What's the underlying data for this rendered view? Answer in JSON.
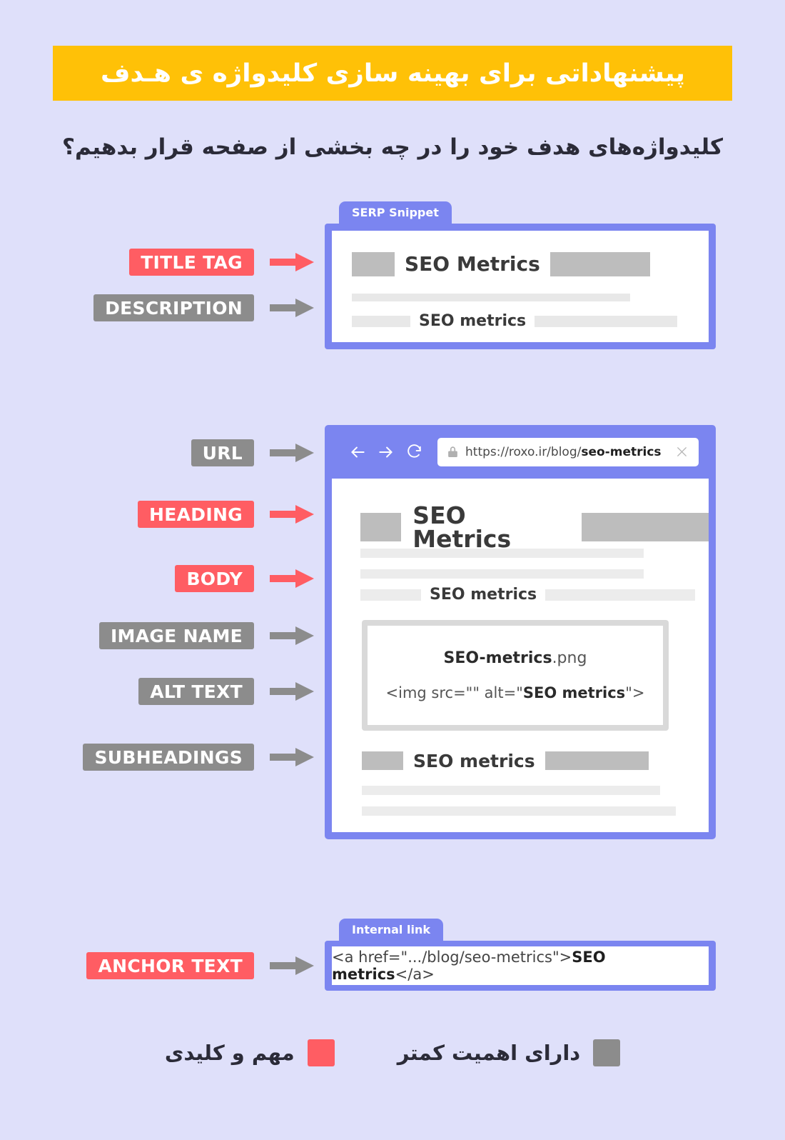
{
  "colors": {
    "background": "#dfe0fa",
    "banner": "#ffc107",
    "accent_blue": "#7b85f0",
    "important_red": "#ff5d63",
    "less_important_gray": "#8c8c8c",
    "placeholder_dark": "#bdbdbd",
    "placeholder_light": "#ececec"
  },
  "header": {
    "banner_title": "پیشنهاداتی برای بهینه سازی کلیدواژه ی هـدف",
    "subtitle_line1": "کلیدواژه‌های هدف خود را در چه بخشی از صفحه قرار بدهیم؟"
  },
  "serp": {
    "tab_label": "SERP Snippet",
    "title_keyword": "SEO Metrics",
    "description_keyword": "SEO metrics"
  },
  "browser": {
    "tab_label": "",
    "nav": {
      "back_icon": "arrow-left-icon",
      "forward_icon": "arrow-right-icon",
      "reload_icon": "reload-icon",
      "lock_icon": "lock-icon",
      "close_icon": "close-icon"
    },
    "url": {
      "prefix": "https://roxo.ir/blog/",
      "keyword": "seo-metrics",
      "full": "https://roxo.ir/blog/seo-metrics"
    },
    "page": {
      "heading_keyword": "SEO Metrics",
      "body_keyword": "SEO metrics",
      "image_name_bold": "SEO-metrics",
      "image_name_ext": ".png",
      "alt_prefix": "<img src=\"\" alt=\"",
      "alt_keyword": "SEO metrics",
      "alt_suffix": "\">",
      "subheading_keyword": "SEO metrics"
    }
  },
  "anchor": {
    "tab_label": "Internal link",
    "code_prefix": "<a href=\".../blog/seo-metrics\">",
    "code_keyword": "SEO metrics",
    "code_suffix": "</a>"
  },
  "labels": [
    {
      "id": "title-tag",
      "text": "TITLE TAG",
      "tag_color": "red",
      "arrow_color": "red"
    },
    {
      "id": "description",
      "text": "DESCRIPTION",
      "tag_color": "gray",
      "arrow_color": "gray"
    },
    {
      "id": "url",
      "text": "URL",
      "tag_color": "gray",
      "arrow_color": "gray"
    },
    {
      "id": "heading",
      "text": "HEADING",
      "tag_color": "red",
      "arrow_color": "red"
    },
    {
      "id": "body",
      "text": "BODY",
      "tag_color": "red",
      "arrow_color": "red"
    },
    {
      "id": "image-name",
      "text": "IMAGE NAME",
      "tag_color": "gray",
      "arrow_color": "gray"
    },
    {
      "id": "alt-text",
      "text": "ALT TEXT",
      "tag_color": "gray",
      "arrow_color": "gray"
    },
    {
      "id": "subheadings",
      "text": "SUBHEADINGS",
      "tag_color": "gray",
      "arrow_color": "gray"
    },
    {
      "id": "anchor-text",
      "text": "ANCHOR TEXT",
      "tag_color": "red",
      "arrow_color": "gray"
    }
  ],
  "legend": {
    "items": [
      {
        "id": "less-important",
        "label": "دارای اهمیت کمتر",
        "color": "#8c8c8c"
      },
      {
        "id": "important",
        "label": "مهم و کلیدی",
        "color": "#ff5d63"
      }
    ]
  }
}
